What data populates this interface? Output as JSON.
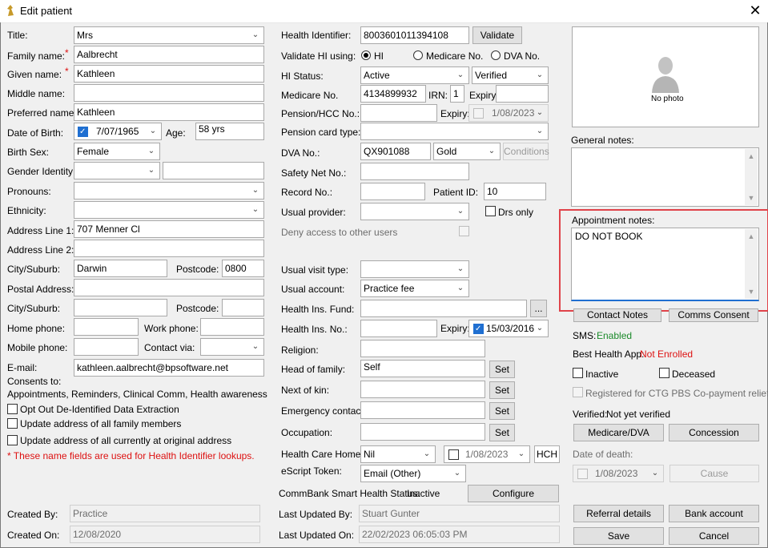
{
  "window": {
    "title": "Edit patient",
    "close_glyph": "✕"
  },
  "left": {
    "title_label": "Title:",
    "title_value": "Mrs",
    "family_label": "Family name:",
    "family_value": "Aalbrecht",
    "given_label": "Given name:",
    "given_value": "Kathleen",
    "middle_label": "Middle name:",
    "middle_value": "",
    "preferred_label": "Preferred name:",
    "preferred_value": "Kathleen",
    "dob_label": "Date of Birth:",
    "dob_value": "7/07/1965",
    "age_label": "Age:",
    "age_value": "58 yrs",
    "birthsex_label": "Birth Sex:",
    "birthsex_value": "Female",
    "gender_label": "Gender Identity:",
    "gender_value": "",
    "pronouns_label": "Pronouns:",
    "pronouns_value": "",
    "ethnicity_label": "Ethnicity:",
    "ethnicity_value": "",
    "addr1_label": "Address Line 1:",
    "addr1_value": "707 Menner Cl",
    "addr2_label": "Address Line 2:",
    "addr2_value": "",
    "city_label": "City/Suburb:",
    "city_value": "Darwin",
    "postcode_label": "Postcode:",
    "postcode_value": "0800",
    "postal_label": "Postal Address:",
    "postal_value": "",
    "city2_label": "City/Suburb:",
    "city2_value": "",
    "postcode2_label": "Postcode:",
    "postcode2_value": "",
    "homephone_label": "Home phone:",
    "homephone_value": "",
    "workphone_label": "Work phone:",
    "workphone_value": "",
    "mobile_label": "Mobile phone:",
    "mobile_value": "",
    "contactvia_label": "Contact via:",
    "contactvia_value": "",
    "email_label": "E-mail:",
    "email_value": "kathleen.aalbrecht@bpsoftware.net",
    "consents_label": "Consents to:",
    "consents_value": "Appointments, Reminders, Clinical Comm, Health awareness",
    "optout_label": "Opt Out De-Identified Data Extraction",
    "update_family_label": "Update address of all family members",
    "update_all_label": "Update address of all currently at original address",
    "note": "* These name fields are used for Health Identifier lookups.",
    "required_mark": "*",
    "created_by_label": "Created By:",
    "created_by_value": "Practice",
    "created_on_label": "Created On:",
    "created_on_value": "12/08/2020"
  },
  "middle": {
    "hi_label": "Health Identifier:",
    "hi_value": "8003601011394108",
    "validate_button": "Validate",
    "validate_using_label": "Validate HI using:",
    "radio_hi": "HI",
    "radio_medicare": "Medicare No.",
    "radio_dva": "DVA No.",
    "hi_status_label": "HI Status:",
    "hi_status_value": "Active",
    "hi_verified_value": "Verified",
    "medicare_label": "Medicare No.",
    "medicare_value": "4134899932",
    "irn_label": "IRN:",
    "irn_value": "1",
    "expiry_label": "Expiry:",
    "medicare_expiry": "",
    "pension_label": "Pension/HCC No.:",
    "pension_value": "",
    "pension_expiry_label": "Expiry:",
    "pension_expiry": "1/08/2023",
    "pension_type_label": "Pension card type:",
    "pension_type_value": "",
    "dva_label": "DVA No.:",
    "dva_value": "QX901088",
    "dva_card": "Gold",
    "conditions_button": "Conditions",
    "safety_label": "Safety Net No.:",
    "safety_value": "",
    "record_label": "Record No.:",
    "record_value": "",
    "patient_id_label": "Patient ID:",
    "patient_id_value": "10",
    "usual_provider_label": "Usual provider:",
    "usual_provider_value": "",
    "drs_only_label": "Drs only",
    "deny_label": "Deny access to other users",
    "visit_type_label": "Usual visit type:",
    "visit_type_value": "",
    "account_label": "Usual account:",
    "account_value": "Practice fee",
    "fund_label": "Health Ins. Fund:",
    "fund_value": "",
    "fund_button": "...",
    "ins_no_label": "Health Ins. No.:",
    "ins_no_value": "",
    "ins_expiry_label": "Expiry:",
    "ins_expiry_value": "15/03/2016",
    "religion_label": "Religion:",
    "religion_value": "",
    "head_label": "Head of family:",
    "head_value": "Self",
    "set_button": "Set",
    "kin_label": "Next of kin:",
    "kin_value": "",
    "emergency_label": "Emergency contact:",
    "emergency_value": "",
    "occupation_label": "Occupation:",
    "occupation_value": "",
    "care_home_label": "Health Care Home:",
    "care_home_value": "Nil",
    "care_home_date": "1/08/2023",
    "hch_button": "HCH",
    "escript_label": "eScript Token:",
    "escript_value": "Email (Other)",
    "commbank_label": "CommBank Smart Health Status:",
    "commbank_value": "Inactive",
    "configure_button": "Configure",
    "updated_by_label": "Last Updated By:",
    "updated_by_value": "Stuart Gunter",
    "updated_on_label": "Last Updated On:",
    "updated_on_value": "22/02/2023 06:05:03 PM"
  },
  "right": {
    "no_photo": "No photo",
    "general_notes_label": "General notes:",
    "general_notes_value": "",
    "appointment_notes_label": "Appointment notes:",
    "appointment_notes_value": "DO NOT BOOK",
    "contact_notes_button": "Contact Notes",
    "comms_consent_button": "Comms Consent",
    "sms_label": "SMS:",
    "sms_value": "Enabled",
    "bha_label": "Best Health App:",
    "bha_value": "Not Enrolled",
    "inactive_label": "Inactive",
    "deceased_label": "Deceased",
    "ctg_label": "Registered for CTG PBS Co-payment relief",
    "verified_label": "Verified:",
    "verified_value": "Not yet verified",
    "medicare_dva_button": "Medicare/DVA",
    "concession_button": "Concession",
    "dod_label": "Date of death:",
    "dod_value": "1/08/2023",
    "cause_button": "Cause",
    "referral_button": "Referral details",
    "bank_button": "Bank account",
    "save_button": "Save",
    "cancel_button": "Cancel"
  },
  "colors": {
    "accent": "#1f6fd1",
    "highlight": "#e0434a",
    "required": "#dd1111",
    "enabled": "#1b8a2a"
  }
}
